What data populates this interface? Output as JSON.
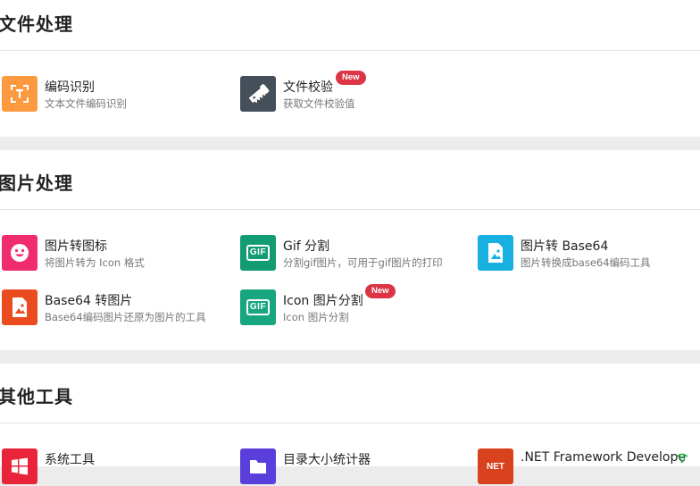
{
  "sections": [
    {
      "title": "文件处理",
      "tools": [
        {
          "name": "编码识别",
          "desc": "文本文件编码识别",
          "icon": "text-scan-icon",
          "color": "#fd9a3f"
        },
        {
          "name": "文件校验",
          "desc": "获取文件校验值",
          "icon": "saw-icon",
          "color": "#444f5a",
          "badge": "New"
        }
      ]
    },
    {
      "title": "图片处理",
      "tools": [
        {
          "name": "图片转图标",
          "desc": "将图片转为 Icon 格式",
          "icon": "smiley-icon",
          "color": "#ef2d6e"
        },
        {
          "name": "Gif 分割",
          "desc": "分割gif图片，可用于gif图片的打印",
          "icon": "gif-icon",
          "color": "#139c74",
          "icon_text": "GIF"
        },
        {
          "name": "图片转 Base64",
          "desc": "图片转换成base64编码工具",
          "icon": "image-file-icon",
          "color": "#17b0e0"
        },
        {
          "name": "Base64 转图片",
          "desc": "Base64编码图片还原为图片的工具",
          "icon": "image-file-icon",
          "color": "#ea4b1f"
        },
        {
          "name": "Icon 图片分割",
          "desc": "Icon 图片分割",
          "icon": "gif-icon",
          "color": "#17a67f",
          "icon_text": "GIF",
          "badge": "New"
        }
      ]
    },
    {
      "title": "其他工具",
      "tools": [
        {
          "name": "系统工具",
          "icon": "windows-icon",
          "color": "#e9243a"
        },
        {
          "name": "目录大小统计器",
          "icon": "folder-icon",
          "color": "#5b3fdc"
        },
        {
          "name": ".NET Framework Develope",
          "icon": "net-icon",
          "color": "#d8421f",
          "icon_text": "NET"
        }
      ]
    }
  ]
}
